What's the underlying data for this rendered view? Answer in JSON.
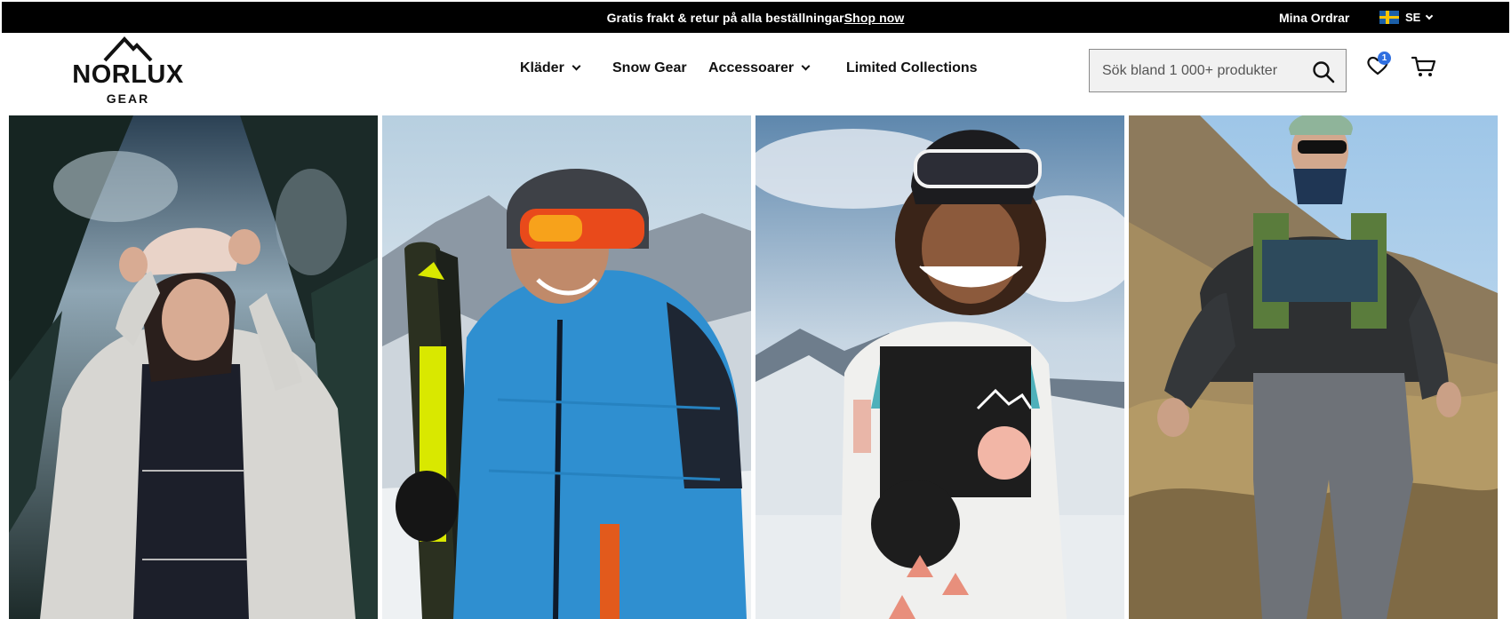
{
  "announcement": {
    "promo_text": "Gratis frakt & retur på alla beställningar",
    "promo_link": "Shop now",
    "orders_label": "Mina Ordrar",
    "locale_label": "SE"
  },
  "brand": {
    "name": "NORLUX",
    "sub": "GEAR"
  },
  "nav": {
    "items": [
      {
        "label": "Kläder",
        "has_dropdown": true
      },
      {
        "label": "Snow Gear",
        "has_dropdown": false
      },
      {
        "label": "Accessoarer",
        "has_dropdown": true
      },
      {
        "label": "Limited Collections",
        "has_dropdown": false
      }
    ]
  },
  "search": {
    "placeholder": "Sök bland 1 000+ produkter",
    "value": ""
  },
  "wishlist": {
    "count": "1"
  },
  "colors": {
    "topbar_bg": "#000000",
    "badge": "#2f6fe0",
    "search_bg": "#f1f1f1"
  },
  "hero": {
    "tiles": [
      {
        "subject": "woman in light jacket and cap under trees"
      },
      {
        "subject": "skier in blue jacket with helmet and goggles holding skis"
      },
      {
        "subject": "smiling snowboarder in patterned jacket with goggles"
      },
      {
        "subject": "hiker in dark shell jacket on grassy mountain slope"
      }
    ]
  },
  "icons": {
    "search": "search-icon",
    "wishlist": "heart-icon",
    "cart": "cart-icon",
    "flag": "sweden-flag-icon",
    "logo_mark": "mountain-logo-icon"
  }
}
